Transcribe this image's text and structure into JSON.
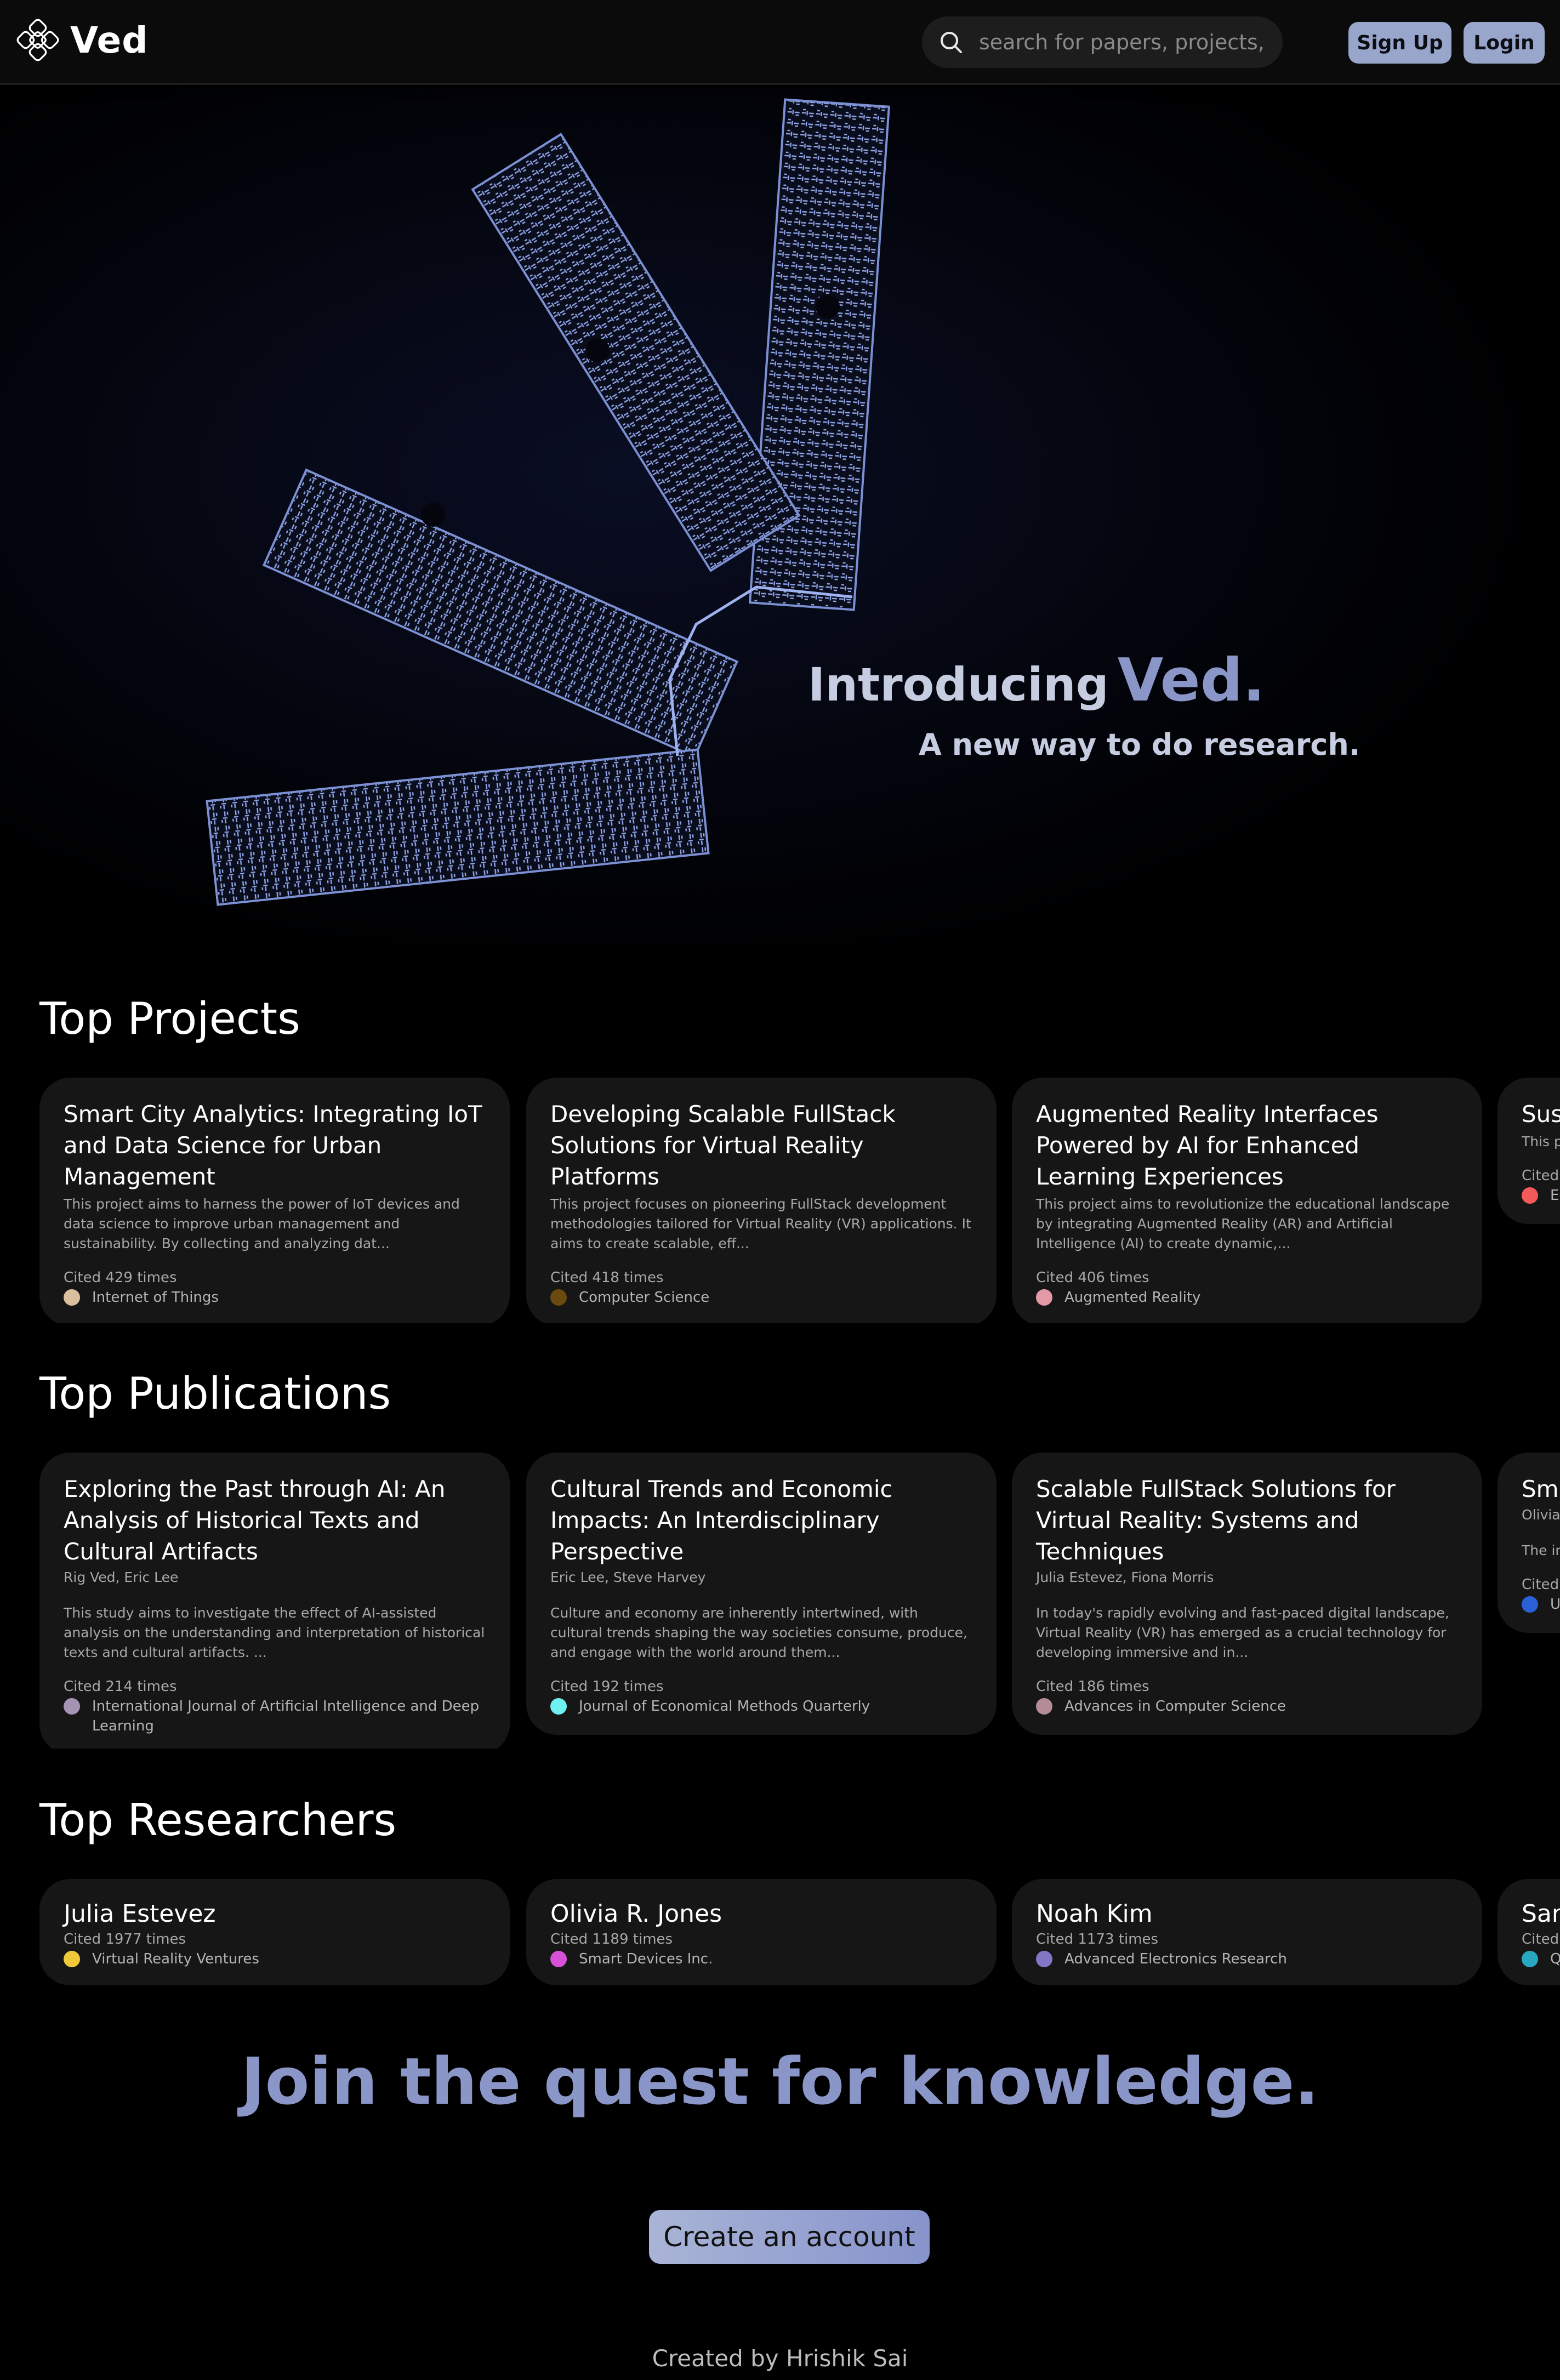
{
  "nav": {
    "brand": "Ved",
    "logo_icon": "knot-logo-icon",
    "search_icon": "search-icon",
    "search_placeholder": "search for papers, projects, etc.",
    "signup_label": "Sign Up",
    "login_label": "Login"
  },
  "hero": {
    "intro": "Introducing",
    "brand": "Ved.",
    "subtitle": "A new way to do research."
  },
  "projects": {
    "heading": "Top Projects",
    "items": [
      {
        "title": "Smart City Analytics: Integrating IoT and Data Science for Urban Management",
        "description": "This project aims to harness the power of IoT devices and data science to improve urban management and sustainability. By collecting and analyzing dat...",
        "cited": "Cited 429 times",
        "tag": "Internet of Things",
        "tag_color": "#d9bf9e"
      },
      {
        "title": "Developing Scalable FullStack Solutions for Virtual Reality Platforms",
        "description": "This project focuses on pioneering FullStack development methodologies tailored for Virtual Reality (VR) applications. It aims to create scalable, eff...",
        "cited": "Cited 418 times",
        "tag": "Computer Science",
        "tag_color": "#6b4a10"
      },
      {
        "title": "Augmented Reality Interfaces Powered by AI for Enhanced Learning Experiences",
        "description": "This project aims to revolutionize the educational landscape by integrating Augmented Reality (AR) and Artificial Intelligence (AI) to create dynamic,...",
        "cited": "Cited 406 times",
        "tag": "Augmented Reality",
        "tag_color": "#e39aa6"
      },
      {
        "title": "Sus Eme",
        "description": "This p that c emerg",
        "cited": "Cited",
        "tag": "Ec",
        "tag_color": "#f25a5a"
      }
    ]
  },
  "publications": {
    "heading": "Top Publications",
    "items": [
      {
        "title": "Exploring the Past through AI: An Analysis of Historical Texts and Cultural Artifacts",
        "authors": "Rig Ved, Eric Lee",
        "description": "This study aims to investigate the effect of AI-assisted analysis on the understanding and interpretation of historical texts and cultural artifacts. ...",
        "cited": "Cited 214 times",
        "tag": "International Journal of Artificial Intelligence and Deep Learning",
        "tag_color": "#a493b3"
      },
      {
        "title": "Cultural Trends and Economic Impacts: An Interdisciplinary Perspective",
        "authors": "Eric Lee, Steve Harvey",
        "description": "Culture and economy are inherently intertwined, with cultural trends shaping the way societies consume, produce, and engage with the world around them...",
        "cited": "Cited 192 times",
        "tag": "Journal of Economical Methods Quarterly",
        "tag_color": "#6ff0f0"
      },
      {
        "title": "Scalable FullStack Solutions for Virtual Reality: Systems and Techniques",
        "authors": "Julia Estevez, Fiona Morris",
        "description": "In today's rapidly evolving and fast-paced digital landscape, Virtual Reality (VR) has emerged as a crucial technology for developing immersive and in...",
        "cited": "Cited 186 times",
        "tag": "Advances in Computer Science",
        "tag_color": "#b38c96"
      },
      {
        "title": "Sma Pow Sus",
        "authors": "Olivia",
        "description": "The in use of wealth",
        "cited": "Cited",
        "tag": "U",
        "tag_color": "#2a5fd6"
      }
    ]
  },
  "researchers": {
    "heading": "Top Researchers",
    "items": [
      {
        "name": "Julia Estevez",
        "cited": "Cited 1977 times",
        "org": "Virtual Reality Ventures",
        "org_color": "#f0c93a"
      },
      {
        "name": "Olivia R. Jones",
        "cited": "Cited 1189 times",
        "org": "Smart Devices Inc.",
        "org_color": "#d84fd8"
      },
      {
        "name": "Noah Kim",
        "cited": "Cited 1173 times",
        "org": "Advanced Electronics Research",
        "org_color": "#8476c4"
      },
      {
        "name": "San",
        "cited": "Cited",
        "org": "Q",
        "org_color": "#28a8c0"
      }
    ]
  },
  "cta": {
    "title": "Join the quest for knowledge.",
    "button": "Create an account"
  },
  "footer": {
    "text": "Created by Hrishik Sai"
  }
}
